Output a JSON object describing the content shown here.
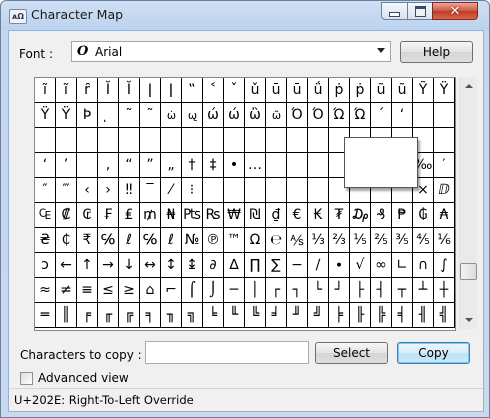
{
  "window": {
    "title": "Character Map",
    "icon": "app-icon-text"
  },
  "font": {
    "label": "Font :",
    "value": "Arial",
    "icon": "opentype-font-icon"
  },
  "buttons": {
    "help": "Help",
    "select": "Select",
    "copy": "Copy"
  },
  "grid": [
    [
      "ĩ",
      "ĩ",
      "ȓ",
      "Ĭ",
      "Ĭ",
      "ǀ",
      "ǀ",
      "‟",
      "˂",
      "ˇ",
      "ǔ",
      "ū",
      "ū",
      "ǘ",
      "ṗ",
      "ṗ",
      "ũ",
      "ũ",
      "Ỹ",
      "Ÿ"
    ],
    [
      "Ϋ",
      "Ϋ",
      "Ϸ",
      "ͅ",
      "˜",
      "˜",
      "ω̇",
      "ω̢",
      "ώ",
      "ώ",
      "ὢ",
      "ω̃",
      "Ό",
      "Ό",
      "Ώ",
      "Ώ",
      "΄",
      "‘",
      "",
      ""
    ],
    [
      "",
      "",
      "",
      "",
      "",
      "",
      "",
      "",
      "",
      "",
      "",
      "",
      "",
      "",
      "",
      "",
      "",
      "",
      "",
      ""
    ],
    [
      "‘",
      "’",
      "",
      "‚",
      "“",
      "”",
      "„",
      "†",
      "‡",
      "•",
      "…",
      "",
      "",
      "",
      "",
      "",
      "",
      "",
      "‰",
      "′"
    ],
    [
      "″",
      "‴",
      "‹",
      "›",
      "‼",
      "‾",
      "⁄",
      "⁝",
      "",
      "",
      "",
      "",
      "",
      "",
      "",
      "",
      "",
      "",
      "×",
      "ⅅ"
    ],
    [
      "₠",
      "₡",
      "₢",
      "₣",
      "₤",
      "₥",
      "₦",
      "₧",
      "₨",
      "₩",
      "₪",
      "₫",
      "€",
      "₭",
      "₮",
      "₯",
      "₰",
      "₱",
      "₲",
      "₳"
    ],
    [
      "₴",
      "₵",
      "₹",
      "℅",
      "ℓ",
      "℅",
      "ℓ",
      "№",
      "℗",
      "™",
      "Ω",
      "℮",
      "⅍",
      "⅓",
      "⅔",
      "⅕",
      "⅖",
      "⅗",
      "⅘",
      "⅙"
    ],
    [
      "ↄ",
      "←",
      "↑",
      "→",
      "↓",
      "↔",
      "↕",
      "↨",
      "∂",
      "∆",
      "∏",
      "∑",
      "−",
      "∕",
      "∙",
      "√",
      "∞",
      "∟",
      "∩",
      "∫"
    ],
    [
      "≈",
      "≠",
      "≡",
      "≤",
      "≥",
      "⌂",
      "⌐",
      "⌠",
      "⌡",
      "─",
      "│",
      "┌",
      "┐",
      "└",
      "┘",
      "├",
      "┤",
      "┬",
      "┴",
      "┼"
    ],
    [
      "═",
      "║",
      "╒",
      "╓",
      "╔",
      "╕",
      "╖",
      "╗",
      "╘",
      "╙",
      "╚",
      "╛",
      "╜",
      "╝",
      "╞",
      "╟",
      "╠",
      "╡",
      "╢",
      "╣"
    ]
  ],
  "copy": {
    "label": "Characters to copy :",
    "value": ""
  },
  "advanced": {
    "label": "Advanced view",
    "checked": false
  },
  "status": "U+202E: Right-To-Left Override"
}
